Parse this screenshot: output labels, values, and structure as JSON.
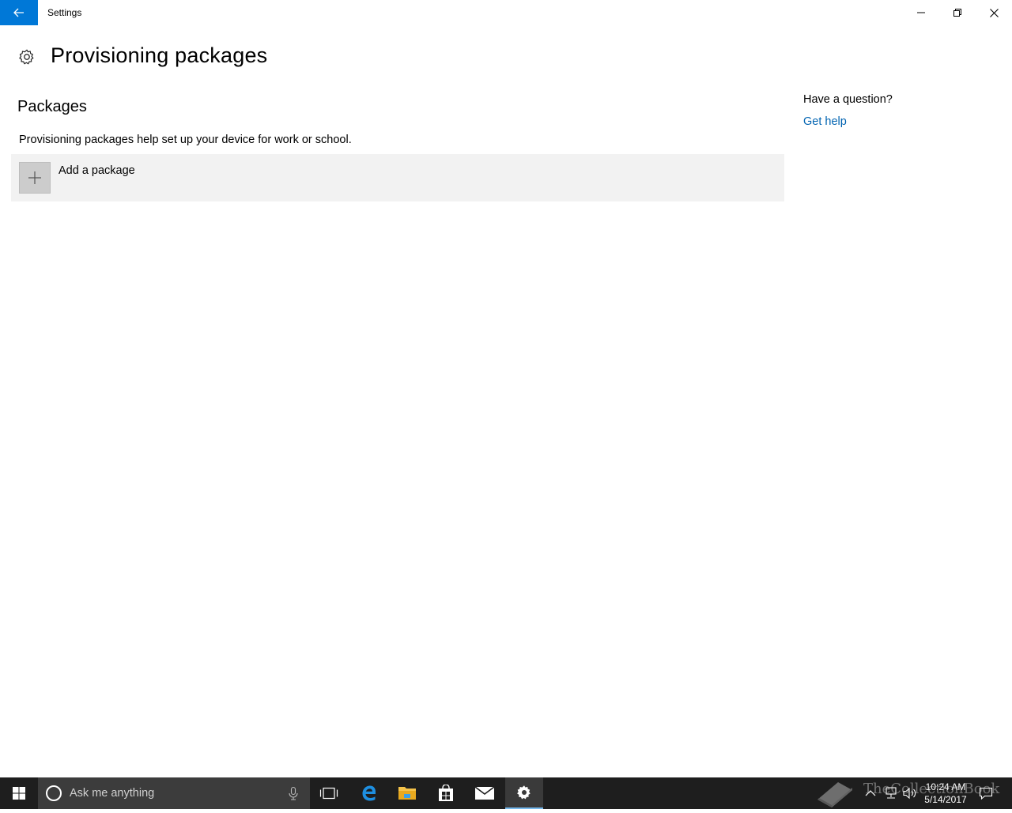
{
  "window": {
    "title": "Settings"
  },
  "page": {
    "title": "Provisioning packages"
  },
  "packages": {
    "section_title": "Packages",
    "description": "Provisioning packages help set up your device for work or school.",
    "add_label": "Add a package"
  },
  "help": {
    "question": "Have a question?",
    "link": "Get help"
  },
  "taskbar": {
    "search_placeholder": "Ask me anything",
    "clock_time": "10:24 AM",
    "clock_date": "5/14/2017"
  },
  "watermark": {
    "text": "TheCollectionBook"
  },
  "colors": {
    "accent": "#0078d7",
    "link": "#0063b1",
    "taskbar": "#1e1e1e"
  }
}
